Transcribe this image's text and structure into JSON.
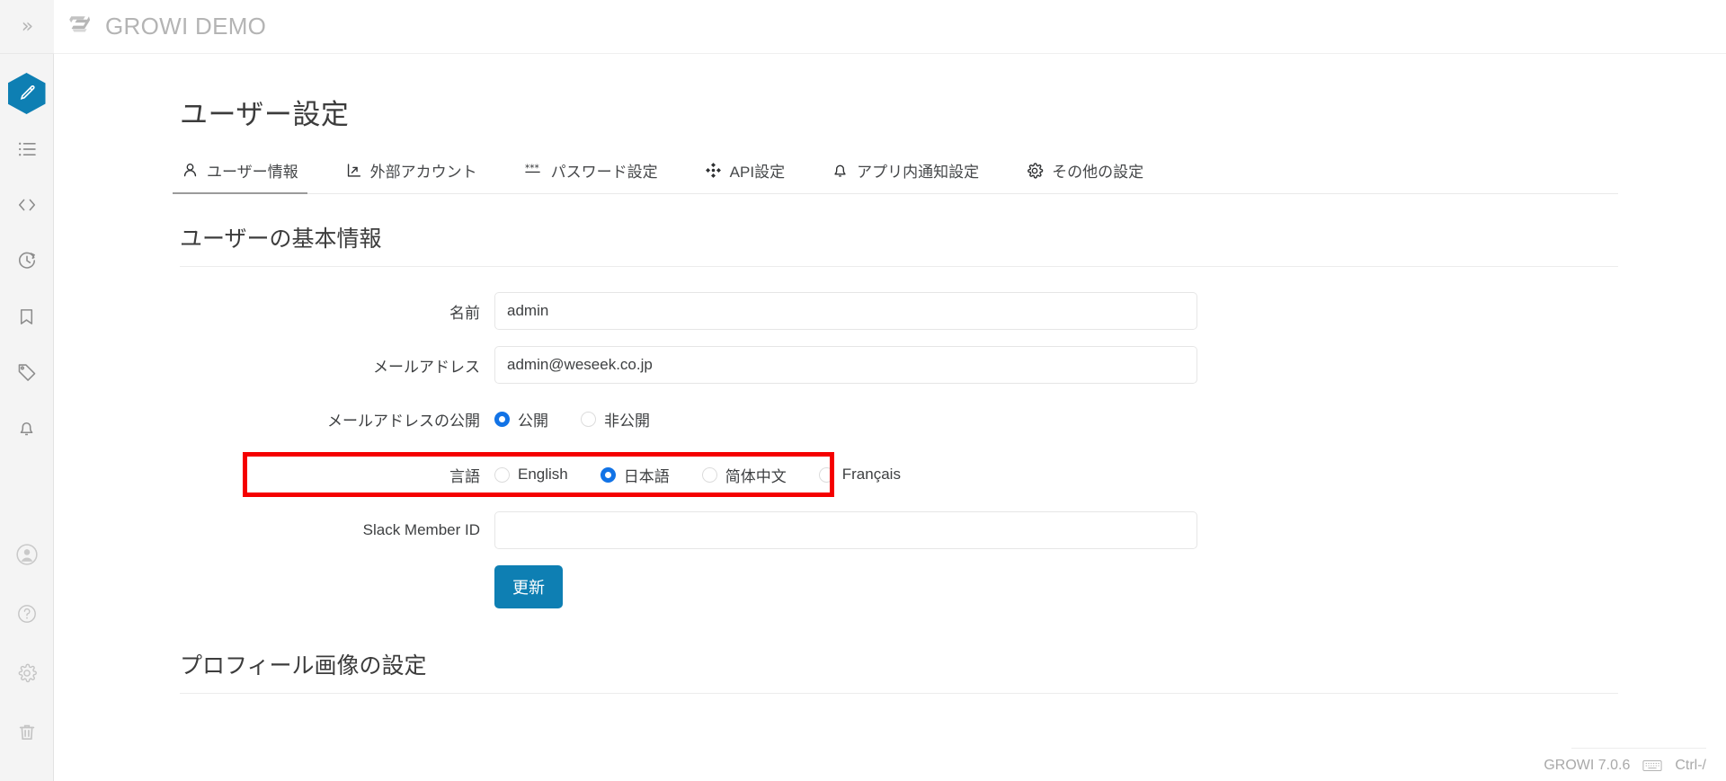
{
  "app": {
    "brand_name": "GROWI DEMO",
    "brand_logo_icon": "growi-logo-icon",
    "collapse_icon": "chevron-double-right-icon"
  },
  "rail": {
    "items": [
      {
        "id": "editor",
        "icon": "pencil-icon",
        "label": "Editor",
        "active": true
      },
      {
        "id": "pagetree",
        "icon": "list-icon",
        "label": "Page Tree",
        "active": false
      },
      {
        "id": "custom",
        "icon": "code-icon",
        "label": "Custom Sidebar",
        "active": false
      },
      {
        "id": "recent",
        "icon": "clock-history-icon",
        "label": "Recent Changes",
        "active": false
      },
      {
        "id": "bookmarks",
        "icon": "bookmark-icon",
        "label": "Bookmarks",
        "active": false
      },
      {
        "id": "tags",
        "icon": "tag-icon",
        "label": "Tags",
        "active": false
      },
      {
        "id": "notify",
        "icon": "bell-icon",
        "label": "Notification",
        "active": false
      }
    ],
    "bottom_items": [
      {
        "id": "account",
        "icon": "person-circle-icon",
        "label": "Account"
      },
      {
        "id": "help",
        "icon": "question-circle-icon",
        "label": "Help"
      },
      {
        "id": "admin",
        "icon": "gear-icon",
        "label": "Admin"
      },
      {
        "id": "trash",
        "icon": "trash-icon",
        "label": "Trash"
      }
    ]
  },
  "page": {
    "title": "ユーザー設定",
    "section_basic_title": "ユーザーの基本情報",
    "section_profile_title": "プロフィール画像の設定"
  },
  "tabs": [
    {
      "id": "user-info",
      "label": "ユーザー情報",
      "icon": "person-icon",
      "active": true
    },
    {
      "id": "external-acct",
      "label": "外部アカウント",
      "icon": "external-link-icon",
      "active": false
    },
    {
      "id": "password",
      "label": "パスワード設定",
      "icon": "asterisk-icon",
      "active": false
    },
    {
      "id": "api",
      "label": "API設定",
      "icon": "api-icon",
      "active": false
    },
    {
      "id": "in-app-notify",
      "label": "アプリ内通知設定",
      "icon": "bell-icon",
      "active": false
    },
    {
      "id": "other",
      "label": "その他の設定",
      "icon": "gear-icon",
      "active": false
    }
  ],
  "form": {
    "name": {
      "label": "名前",
      "value": "admin",
      "placeholder": ""
    },
    "email": {
      "label": "メールアドレス",
      "value": "admin@weseek.co.jp",
      "placeholder": ""
    },
    "email_visibility": {
      "label": "メールアドレスの公開",
      "options": [
        {
          "id": "public",
          "label": "公開",
          "selected": true
        },
        {
          "id": "private",
          "label": "非公開",
          "selected": false
        }
      ]
    },
    "language": {
      "label": "言語",
      "highlighted": true,
      "highlight_color": "#f50000",
      "options": [
        {
          "id": "en_US",
          "label": "English",
          "selected": false
        },
        {
          "id": "ja_JP",
          "label": "日本語",
          "selected": true
        },
        {
          "id": "zh_CN",
          "label": "简体中文",
          "selected": false
        },
        {
          "id": "fr_FR",
          "label": "Français",
          "selected": false
        }
      ]
    },
    "slack_member_id": {
      "label": "Slack Member ID",
      "value": "",
      "placeholder": ""
    },
    "submit_label": "更新"
  },
  "footer": {
    "version": "GROWI 7.0.6",
    "shortcut": "Ctrl-/",
    "keyboard_icon": "keyboard-icon"
  },
  "colors": {
    "accent": "#0e7fb3",
    "radio_selected": "#1273e6",
    "highlight": "#f50000",
    "brand_text": "#b4b4b4"
  }
}
